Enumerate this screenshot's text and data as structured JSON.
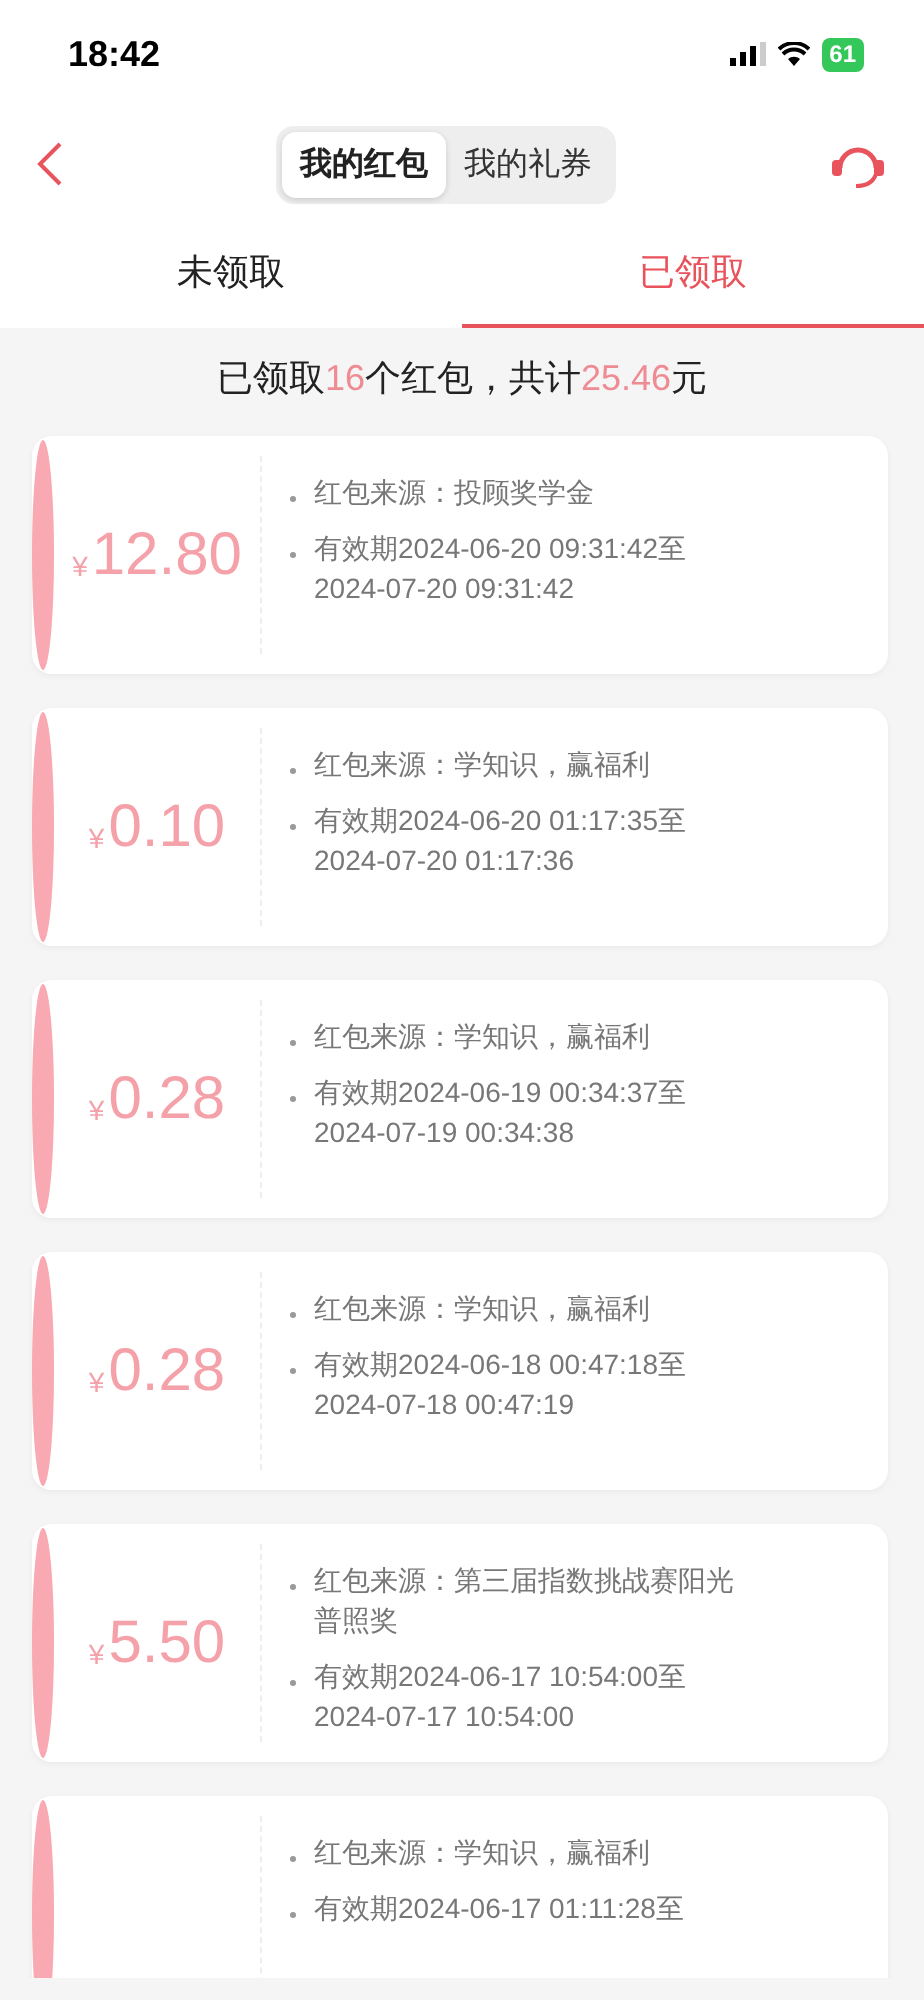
{
  "status_bar": {
    "time": "18:42",
    "battery": "61"
  },
  "header": {
    "segments": [
      {
        "label": "我的红包",
        "selected": true
      },
      {
        "label": "我的礼券",
        "selected": false
      }
    ]
  },
  "tabs": [
    {
      "label": "未领取",
      "selected": false
    },
    {
      "label": "已领取",
      "selected": true
    }
  ],
  "summary": "已领取**16**个红包，共计**25.46**元",
  "red_packets": [
    {
      "currency": "¥",
      "amount": "12.80",
      "source": "红包来源：投顾奖学金",
      "validity": [
        "有效期2024-06-20 09:31:42至",
        "2024-07-20 09:31:42"
      ]
    },
    {
      "currency": "¥",
      "amount": "0.10",
      "source": "红包来源：学知识，赢福利",
      "validity": [
        "有效期2024-06-20 01:17:35至",
        "2024-07-20 01:17:36"
      ]
    },
    {
      "currency": "¥",
      "amount": "0.28",
      "source": "红包来源：学知识，赢福利",
      "validity": [
        "有效期2024-06-19 00:34:37至",
        "2024-07-19 00:34:38"
      ]
    },
    {
      "currency": "¥",
      "amount": "0.28",
      "source": "红包来源：学知识，赢福利",
      "validity": [
        "有效期2024-06-18 00:47:18至",
        "2024-07-18 00:47:19"
      ]
    },
    {
      "currency": "¥",
      "amount": "5.50",
      "source": "红包来源：第三届指数挑战赛阳光普照奖",
      "validity": [
        "有效期2024-06-17 10:54:00至",
        "2024-07-17 10:54:00"
      ]
    },
    {
      "source": "红包来源：学知识，赢福利",
      "validity": [
        "有效期2024-06-17 01:11:28至"
      ]
    }
  ]
}
